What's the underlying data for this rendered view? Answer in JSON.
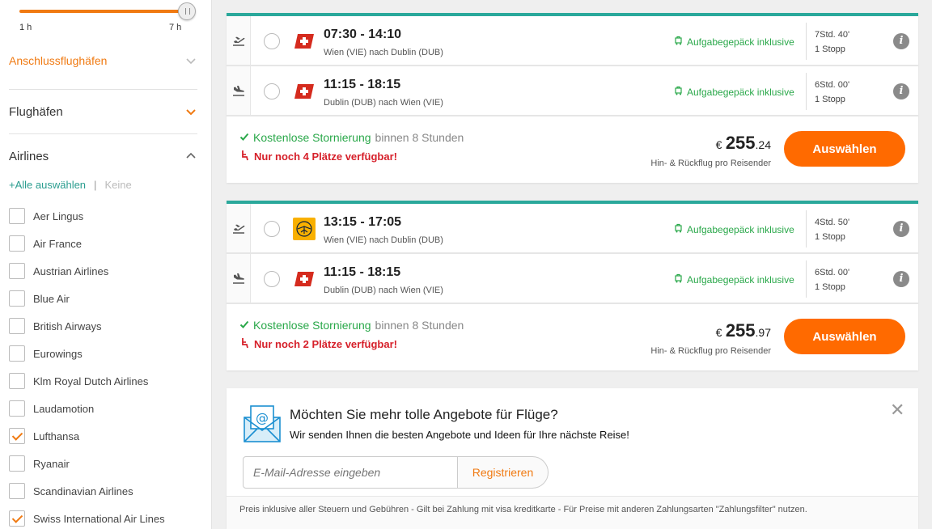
{
  "sidebar": {
    "slider": {
      "min_label": "1 h",
      "max_label": "7 h"
    },
    "connecting_airports": "Anschlussflughäfen",
    "airports": "Flughäfen",
    "airlines_title": "Airlines",
    "select_all": "+Alle auswählen",
    "separator": "|",
    "select_none": "Keine",
    "airlines": [
      {
        "name": "Aer Lingus",
        "checked": false
      },
      {
        "name": "Air France",
        "checked": false
      },
      {
        "name": "Austrian Airlines",
        "checked": false
      },
      {
        "name": "Blue Air",
        "checked": false
      },
      {
        "name": "British Airways",
        "checked": false
      },
      {
        "name": "Eurowings",
        "checked": false
      },
      {
        "name": "Klm Royal Dutch Airlines",
        "checked": false
      },
      {
        "name": "Laudamotion",
        "checked": false
      },
      {
        "name": "Lufthansa",
        "checked": true
      },
      {
        "name": "Ryanair",
        "checked": false
      },
      {
        "name": "Scandinavian Airlines",
        "checked": false
      },
      {
        "name": "Swiss International Air Lines",
        "checked": true
      }
    ]
  },
  "offers": [
    {
      "legs": [
        {
          "direction": "outbound",
          "airline_logo": "swiss-logo",
          "times": "07:30 - 14:10",
          "route": "Wien (VIE) nach Dublin (DUB)",
          "baggage": "Aufgabegepäck inklusive",
          "duration": "7Std. 40'",
          "stops": "1 Stopp"
        },
        {
          "direction": "return",
          "airline_logo": "swiss-logo",
          "times": "11:15 - 18:15",
          "route": "Dublin (DUB) nach Wien (VIE)",
          "baggage": "Aufgabegepäck inklusive",
          "duration": "6Std. 00'",
          "stops": "1 Stopp"
        }
      ],
      "cancel_highlight": "Kostenlose Stornierung",
      "cancel_rest": "binnen 8 Stunden",
      "seats": "Nur noch 4 Plätze verfügbar!",
      "currency": "€",
      "price_main": "255",
      "price_cents": ".24",
      "price_note": "Hin- & Rückflug pro Reisender",
      "button": "Auswählen"
    },
    {
      "legs": [
        {
          "direction": "outbound",
          "airline_logo": "lufthansa-logo",
          "times": "13:15 - 17:05",
          "route": "Wien (VIE) nach Dublin (DUB)",
          "baggage": "Aufgabegepäck inklusive",
          "duration": "4Std. 50'",
          "stops": "1 Stopp"
        },
        {
          "direction": "return",
          "airline_logo": "swiss-logo",
          "times": "11:15 - 18:15",
          "route": "Dublin (DUB) nach Wien (VIE)",
          "baggage": "Aufgabegepäck inklusive",
          "duration": "6Std. 00'",
          "stops": "1 Stopp"
        }
      ],
      "cancel_highlight": "Kostenlose Stornierung",
      "cancel_rest": "binnen 8 Stunden",
      "seats": "Nur noch 2 Plätze verfügbar!",
      "currency": "€",
      "price_main": "255",
      "price_cents": ".97",
      "price_note": "Hin- & Rückflug pro Reisender",
      "button": "Auswählen"
    }
  ],
  "newsletter": {
    "title": "Möchten Sie mehr tolle Angebote für Flüge?",
    "subtitle": "Wir senden Ihnen die besten Angebote und Ideen für Ihre nächste Reise!",
    "email_placeholder": "E-Mail-Adresse eingeben",
    "register_button": "Registrieren",
    "close": "✕",
    "footer": "Preis inklusive aller Steuern und Gebühren - Gilt bei Zahlung mit visa kreditkarte - Für Preise mit anderen Zahlungsarten \"Zahlungsfilter\" nutzen."
  },
  "colors": {
    "accent": "#f07a12",
    "teal": "#2aa89b",
    "green": "#2aa84a",
    "red": "#d6202a",
    "button": "#ff6a00"
  }
}
